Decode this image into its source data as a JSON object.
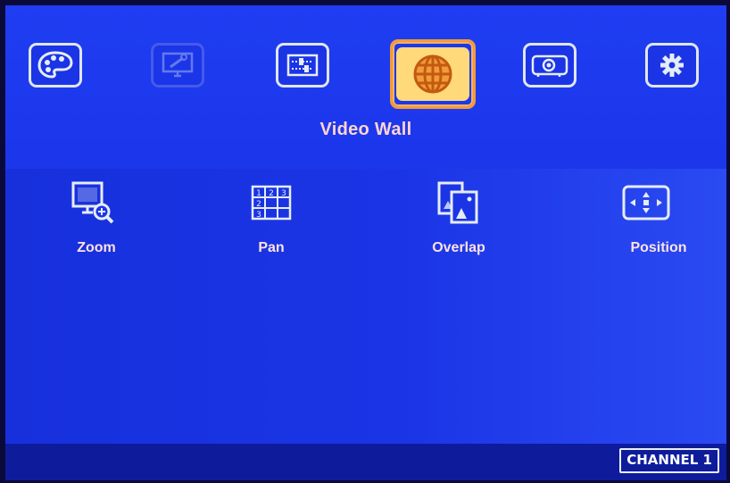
{
  "menu": {
    "tabs": [
      {
        "icon": "palette-icon"
      },
      {
        "icon": "monitor-settings-icon"
      },
      {
        "icon": "sliders-icon"
      },
      {
        "icon": "globe-icon"
      },
      {
        "icon": "projector-icon"
      },
      {
        "icon": "gear-icon"
      }
    ],
    "active_tab_index": 3,
    "active_title": "Video Wall"
  },
  "functions": [
    {
      "label": "Zoom",
      "icon": "zoom-monitor-icon"
    },
    {
      "label": "Pan",
      "icon": "grid-numbers-icon",
      "grid_numbers": [
        "1",
        "2",
        "3",
        "2",
        "3"
      ]
    },
    {
      "label": "Overlap",
      "icon": "overlap-icon"
    },
    {
      "label": "Position",
      "icon": "position-arrows-icon"
    }
  ],
  "status": {
    "channel": "CHANNEL 1"
  },
  "colors": {
    "background": "#1a30e0",
    "highlight_border": "#f39a3a",
    "title_text": "#ffd5d0"
  }
}
